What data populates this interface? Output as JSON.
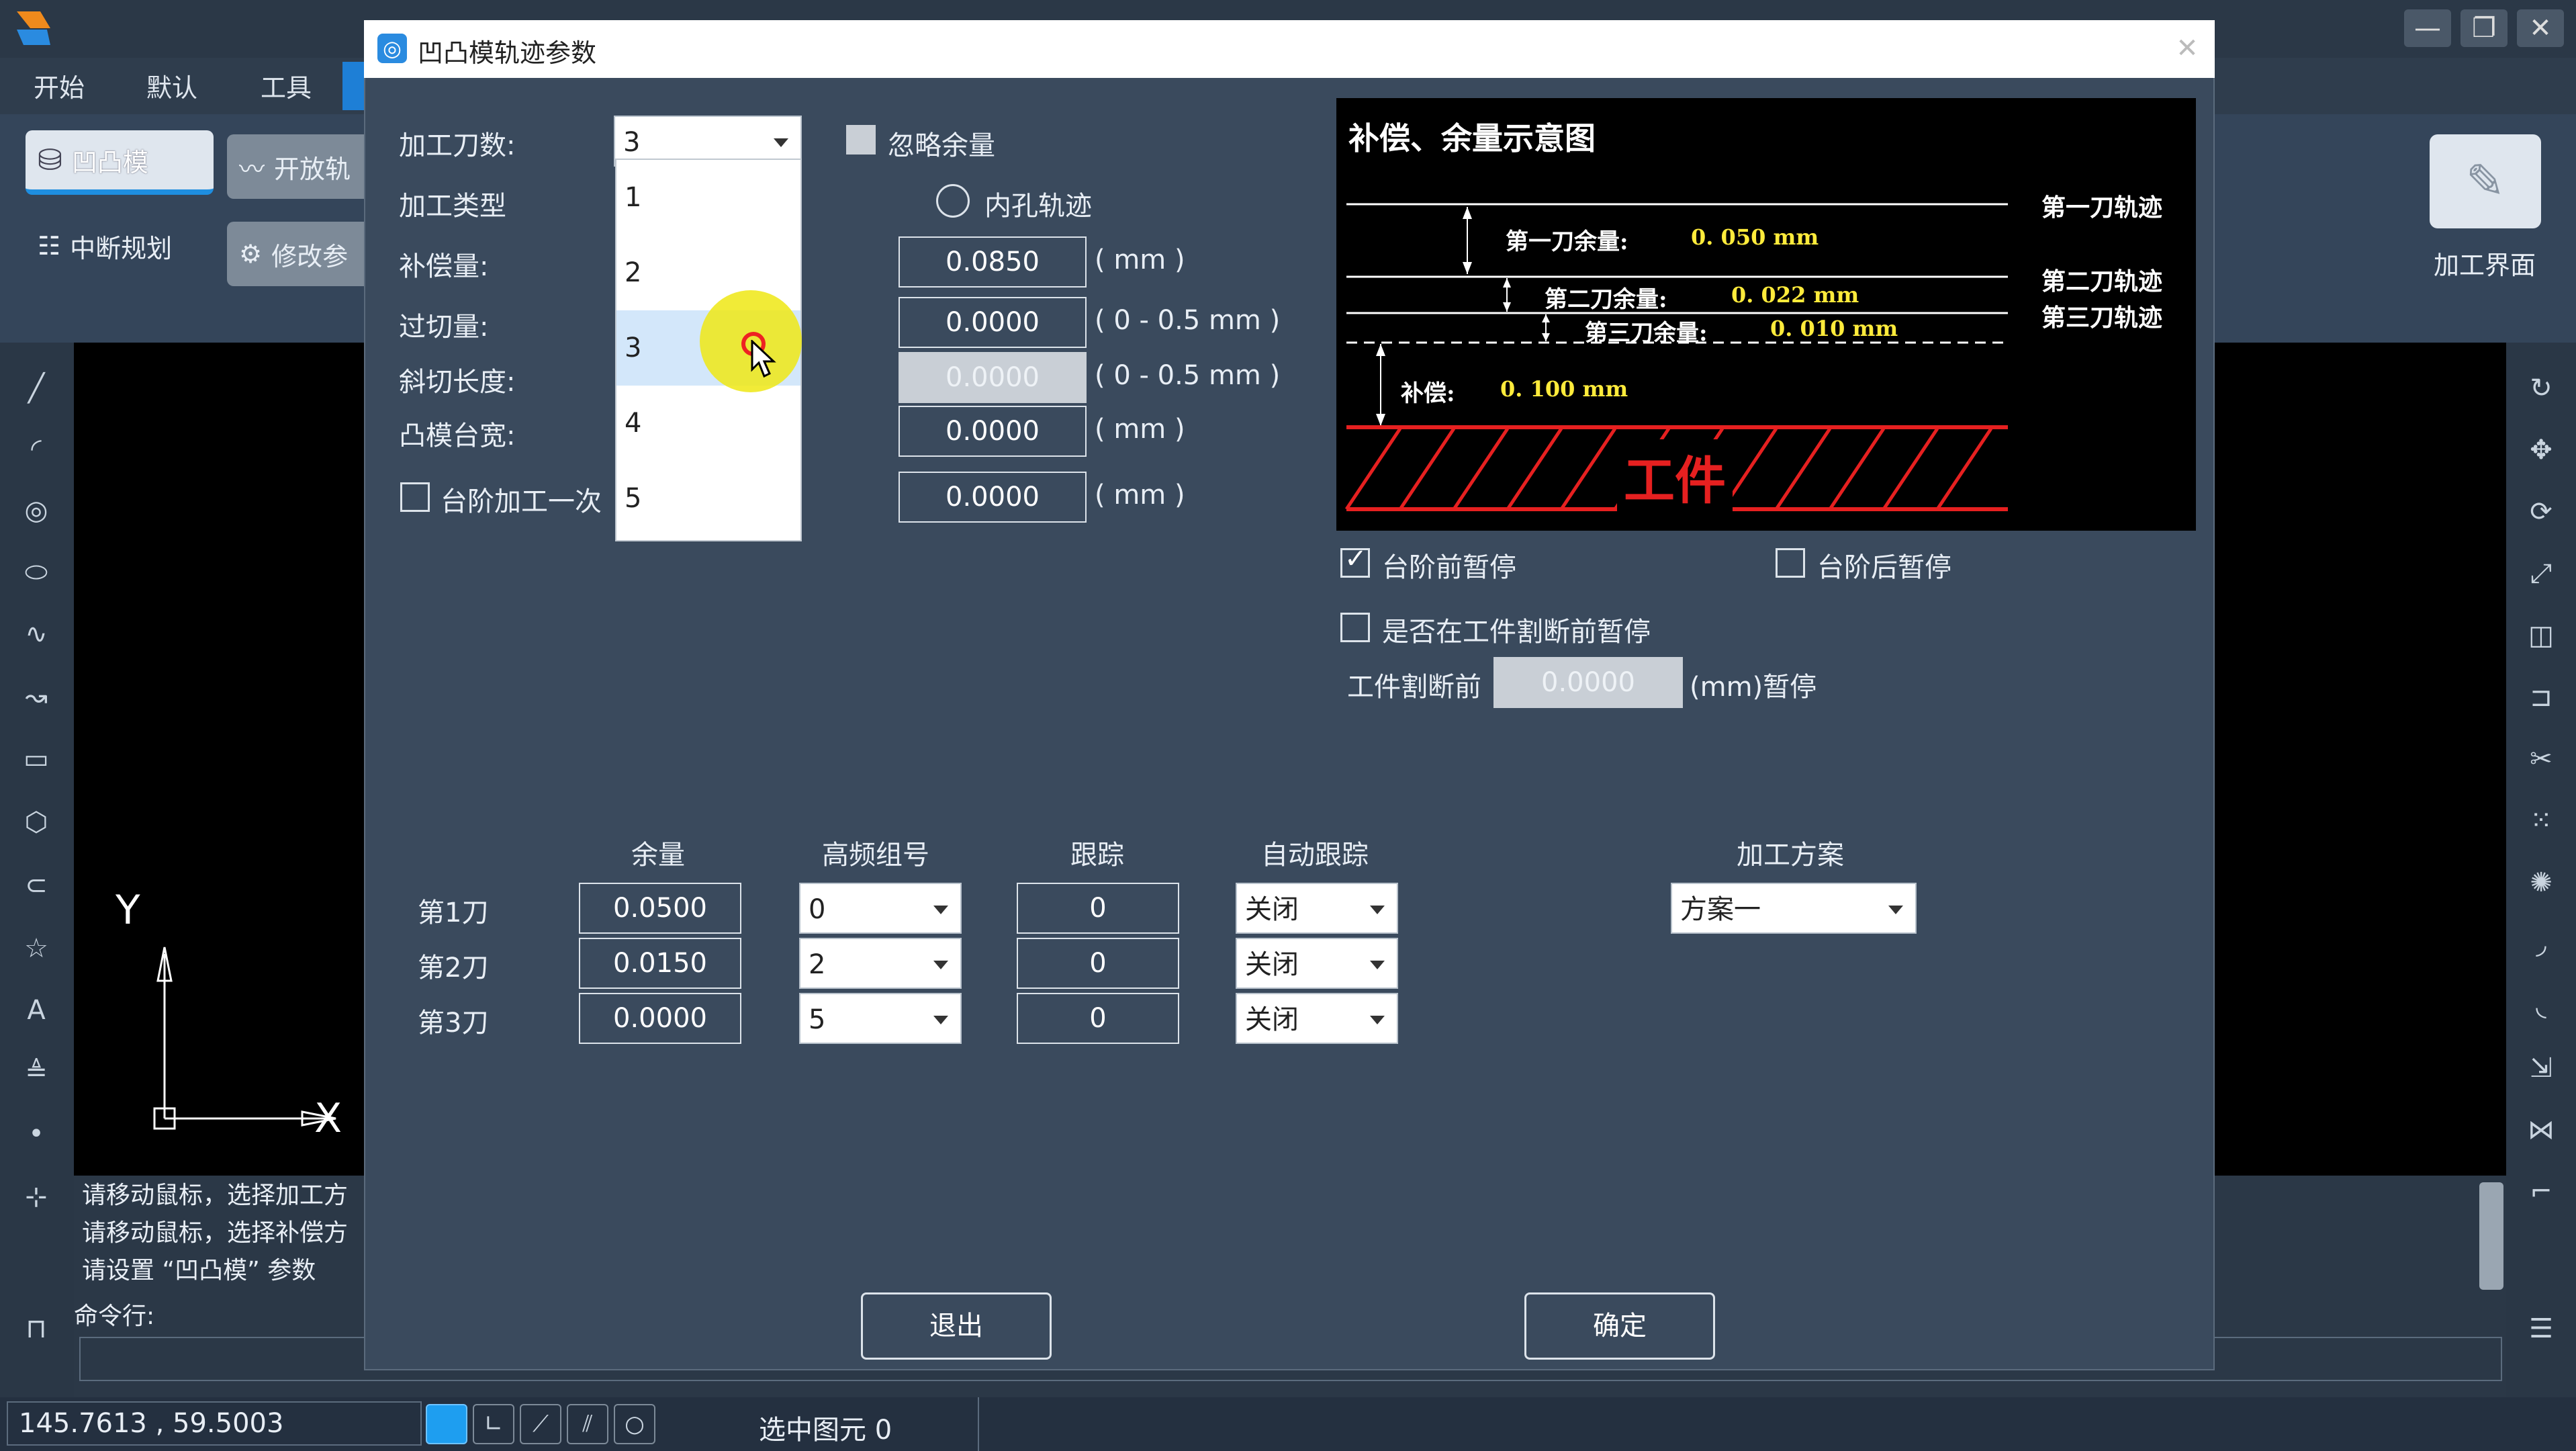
{
  "app": {
    "menus": [
      "开始",
      "默认",
      "工具"
    ],
    "ribbon": {
      "die_button": "凹凸模",
      "open_button": "开放轨",
      "break_plan": "中断规划",
      "modify_button": "修改参",
      "process_ui": "加工界面"
    },
    "canvas": {
      "axis_y": "Y",
      "axis_x": "X"
    },
    "messages": [
      "请移动鼠标，选择加工方",
      "请移动鼠标，选择补偿方",
      "请设置 “凹凸模” 参数"
    ],
    "command_label": "命令行:",
    "status": {
      "coords": "145.7613 , 59.5003",
      "selected": "选中图元 0"
    }
  },
  "dialog": {
    "title": "凹凸模轨迹参数",
    "labels": {
      "cut_count": "加工刀数:",
      "process_type": "加工类型",
      "compensation": "补偿量:",
      "overcut": "过切量:",
      "bevel_length": "斜切长度:",
      "platform_width": "凸模台宽:",
      "step_once": "台阶加工一次"
    },
    "cut_count_value": "3",
    "dropdown_options": [
      "1",
      "2",
      "3",
      "4",
      "5"
    ],
    "dropdown_highlight": "3",
    "ignore_allowance": "忽略余量",
    "inner_hole": "内孔轨迹",
    "fields": {
      "compensation": {
        "value": "0.0850",
        "unit": "( mm )"
      },
      "overcut": {
        "value": "0.0000",
        "unit": "( 0 - 0.5 mm )"
      },
      "bevel": {
        "value": "0.0000",
        "unit": "( 0 - 0.5 mm )"
      },
      "platform": {
        "value": "0.0000",
        "unit": "( mm )"
      },
      "step": {
        "value": "0.0000",
        "unit": "( mm )"
      }
    },
    "diagram": {
      "title": "补偿、余量示意图",
      "track1": "第一刀轨迹",
      "track2": "第二刀轨迹",
      "track3": "第三刀轨迹",
      "allow1_label": "第一刀余量:",
      "allow1_value": "0. 050  mm",
      "allow2_label": "第二刀余量:",
      "allow2_value": "0. 022  mm",
      "allow3_label": "第三刀余量:",
      "allow3_value": "0. 010  mm",
      "comp_label": "补偿:",
      "comp_value": "0. 100  mm",
      "workpiece": "工件"
    },
    "pause_before_step": "台阶前暂停",
    "pause_after_step": "台阶后暂停",
    "pause_before_cutoff": "是否在工件割断前暂停",
    "cutoff_label": "工件割断前",
    "cutoff_value": "0.0000",
    "cutoff_suffix": "(mm)暂停",
    "table": {
      "headers": [
        "余量",
        "高频组号",
        "跟踪",
        "自动跟踪"
      ],
      "rows": [
        {
          "name": "第1刀",
          "allowance": "0.0500",
          "group": "0",
          "track": "0",
          "auto": "关闭"
        },
        {
          "name": "第2刀",
          "allowance": "0.0150",
          "group": "2",
          "track": "0",
          "auto": "关闭"
        },
        {
          "name": "第3刀",
          "allowance": "0.0000",
          "group": "5",
          "track": "0",
          "auto": "关闭"
        }
      ]
    },
    "plan_label": "加工方案",
    "plan_value": "方案一",
    "exit_button": "退出",
    "ok_button": "确定"
  }
}
